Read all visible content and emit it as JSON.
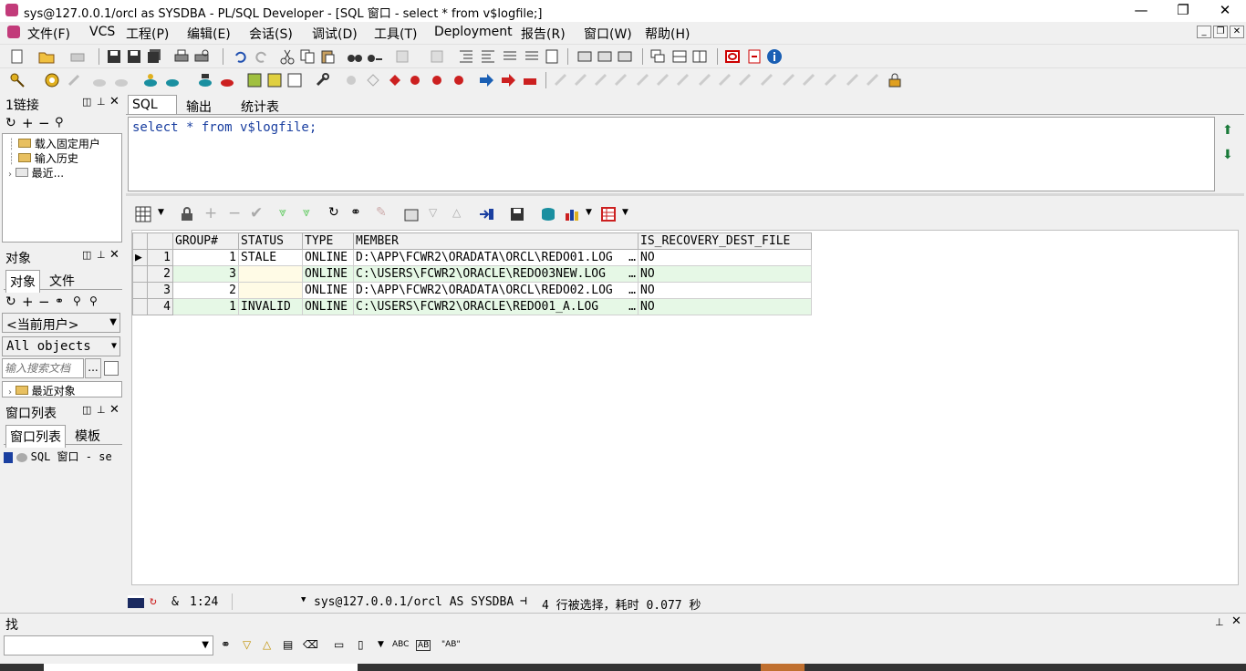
{
  "window": {
    "title": "sys@127.0.0.1/orcl as SYSDBA - PL/SQL Developer - [SQL 窗口 - select * from v$logfile;]",
    "minimize": "—",
    "restore": "❐",
    "close": "✕"
  },
  "menu": [
    "文件(F)",
    "VCS",
    "工程(P)",
    "编辑(E)",
    "会话(S)",
    "调试(D)",
    "工具(T)",
    "Deployment",
    "报告(R)",
    "窗口(W)",
    "帮助(H)"
  ],
  "mdi": {
    "minimize": "_",
    "restore": "❐",
    "close": "✕"
  },
  "connections_panel": {
    "title": "1链接",
    "tree": [
      "载入固定用户",
      "输入历史",
      "最近..."
    ]
  },
  "objects_panel": {
    "title": "对象",
    "tabs": [
      "对象",
      "文件"
    ],
    "user_combo": "<当前用户>",
    "type_combo": "All objects",
    "search_placeholder": "输入搜索文档",
    "search_btn": "...",
    "recent": "最近对象"
  },
  "windows_panel": {
    "title": "窗口列表",
    "tabs": [
      "窗口列表",
      "模板"
    ],
    "item": "SQL 窗口 - se"
  },
  "editor": {
    "tabs": [
      "SQL",
      "输出",
      "统计表"
    ],
    "sql": "select * from v$logfile;"
  },
  "result_grid": {
    "columns": [
      "GROUP#",
      "STATUS",
      "TYPE",
      "MEMBER",
      "IS_RECOVERY_DEST_FILE"
    ],
    "rows": [
      {
        "n": "1",
        "group": "1",
        "status": "STALE",
        "type": "ONLINE",
        "member": "D:\\APP\\FCWR2\\ORADATA\\ORCL\\REDO01.LOG",
        "dest": "NO"
      },
      {
        "n": "2",
        "group": "3",
        "status": "",
        "type": "ONLINE",
        "member": "C:\\USERS\\FCWR2\\ORACLE\\REDO03NEW.LOG",
        "dest": "NO"
      },
      {
        "n": "3",
        "group": "2",
        "status": "",
        "type": "ONLINE",
        "member": "D:\\APP\\FCWR2\\ORADATA\\ORCL\\REDO02.LOG",
        "dest": "NO"
      },
      {
        "n": "4",
        "group": "1",
        "status": "INVALID",
        "type": "ONLINE",
        "member": "C:\\USERS\\FCWR2\\ORACLE\\REDO01_A.LOG",
        "dest": "NO"
      }
    ],
    "ellipsis": "…"
  },
  "status_bar": {
    "amp": "&",
    "position": "1:24",
    "connection": "sys@127.0.0.1/orcl AS SYSDBA",
    "message": "4 行被选择，耗时 0.077 秒"
  },
  "find_panel": {
    "title": "找",
    "labels": [
      "ABC",
      "AB",
      "\"AB\""
    ]
  },
  "colors": {
    "row_alt": "#e6f8e6",
    "accent_red": "#cc0000",
    "accent_blue": "#1a5fb4"
  }
}
